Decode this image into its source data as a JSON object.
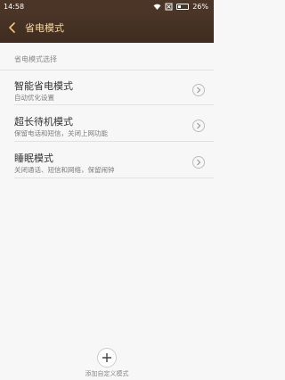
{
  "status": {
    "time": "14:58",
    "battery": "26%"
  },
  "header": {
    "title": "省电模式"
  },
  "section_label": "省电模式选择",
  "modes": [
    {
      "title": "智能省电模式",
      "subtitle": "自动优化设置"
    },
    {
      "title": "超长待机模式",
      "subtitle": "保留电话和短信，关闭上网功能"
    },
    {
      "title": "睡眠模式",
      "subtitle": "关闭通话、短信和网络，保留闹钟"
    }
  ],
  "add_custom": {
    "label": "添加自定义模式"
  }
}
